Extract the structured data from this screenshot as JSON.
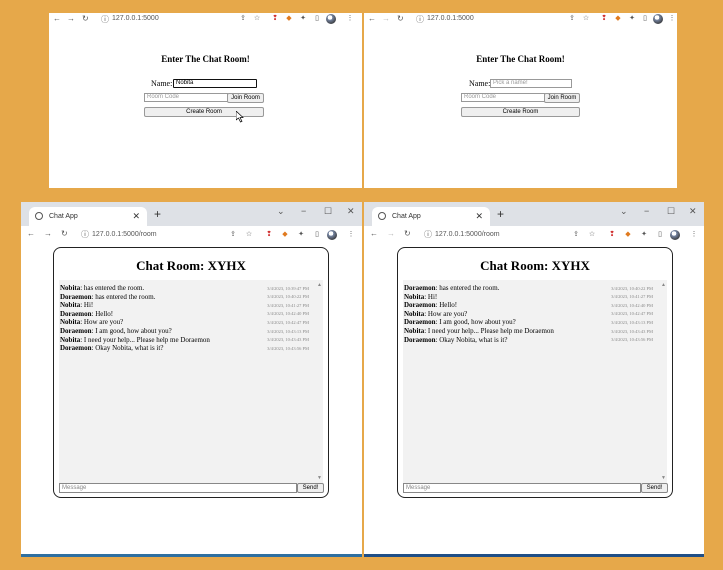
{
  "url_home": "127.0.0.1:5000",
  "url_room": "127.0.0.1:5000/room",
  "tab_title": "Chat App",
  "new_tab": "+",
  "window_controls": {
    "chevron": "⌄",
    "minimize": "−",
    "maximize": "☐",
    "close": "✕"
  },
  "nav": {
    "back": "←",
    "forward": "→",
    "reload": "↻",
    "info": "ⓘ"
  },
  "lobby": {
    "title": "Enter The Chat Room!",
    "name_label": "Name:",
    "name_value_left": "Nobita",
    "name_placeholder": "Pick a name!",
    "room_code_placeholder": "Room Code",
    "join_button": "Join Room",
    "create_button": "Create Room"
  },
  "room": {
    "title": "Chat Room: XYHX",
    "message_placeholder": "Message",
    "send_button": "Send!",
    "left_messages": [
      {
        "name": "Nobita",
        "text": ": has entered the room.",
        "time": "3/4/2023, 10:39:47 PM"
      },
      {
        "name": "Doraemon",
        "text": ": has entered the room.",
        "time": "3/4/2023, 10:40:22 PM"
      },
      {
        "name": "Nobita",
        "text": ": Hi!",
        "time": "3/4/2023, 10:41:27 PM"
      },
      {
        "name": "Doraemon",
        "text": ": Hello!",
        "time": "3/4/2023, 10:42:40 PM"
      },
      {
        "name": "Nobita",
        "text": ": How are you?",
        "time": "3/4/2023, 10:42:47 PM"
      },
      {
        "name": "Doraemon",
        "text": ": I am good, how about you?",
        "time": "3/4/2023, 10:43:13 PM"
      },
      {
        "name": "Nobita",
        "text": ": I need your help... Please help me Doraemon",
        "time": "3/4/2023, 10:43:43 PM"
      },
      {
        "name": "Doraemon",
        "text": ": Okay Nobita, what is it?",
        "time": "3/4/2023, 10:43:56 PM"
      }
    ],
    "right_messages": [
      {
        "name": "Doraemon",
        "text": ": has entered the room.",
        "time": "3/4/2023, 10:40:22 PM"
      },
      {
        "name": "Nobita",
        "text": ": Hi!",
        "time": "3/4/2023, 10:41:27 PM"
      },
      {
        "name": "Doraemon",
        "text": ": Hello!",
        "time": "3/4/2023, 10:42:40 PM"
      },
      {
        "name": "Nobita",
        "text": ": How are you?",
        "time": "3/4/2023, 10:42:47 PM"
      },
      {
        "name": "Doraemon",
        "text": ": I am good, how about you?",
        "time": "3/4/2023, 10:43:13 PM"
      },
      {
        "name": "Nobita",
        "text": ": I need your help... Please help me Doraemon",
        "time": "3/4/2023, 10:43:43 PM"
      },
      {
        "name": "Doraemon",
        "text": ": Okay Nobita, what is it?",
        "time": "3/4/2023, 10:43:56 PM"
      }
    ]
  },
  "toolbar_icons": [
    "share-icon",
    "star-icon",
    "pin-extension-icon",
    "fox-extension-icon",
    "puzzle-icon",
    "sidepanel-icon",
    "avatar",
    "menu-icon"
  ],
  "colors": {
    "frame": "#E6A84A",
    "tabstrip": "#DEE1E6",
    "taskbar": "#2E6FA0"
  }
}
